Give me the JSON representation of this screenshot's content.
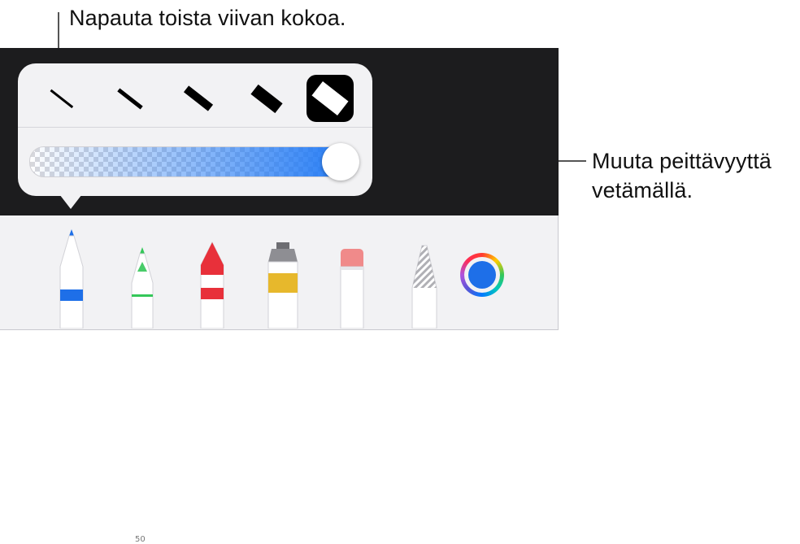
{
  "callouts": {
    "line_size": "Napauta toista viivan kokoa.",
    "opacity_line1": "Muuta peittävyyttä",
    "opacity_line2": "vetämällä."
  },
  "popover": {
    "line_sizes": [
      "size-1",
      "size-2",
      "size-3",
      "size-4",
      "size-5"
    ],
    "selected_size": 5,
    "opacity": 1.0,
    "opacity_color": "#1e78f5"
  },
  "toolbar": {
    "tools": [
      {
        "name": "pen",
        "tip_color": "#1e6fe8",
        "selected": true
      },
      {
        "name": "pencil",
        "tip_color": "#34c759",
        "width_label": "50"
      },
      {
        "name": "crayon",
        "tip_color": "#e8303a"
      },
      {
        "name": "paint",
        "band_color": "#e7b82c"
      },
      {
        "name": "eraser",
        "tip_color": "#f08a8a"
      },
      {
        "name": "ruler-pencil",
        "tip_color": "#999999"
      }
    ],
    "current_color": "#1e6fe8"
  }
}
